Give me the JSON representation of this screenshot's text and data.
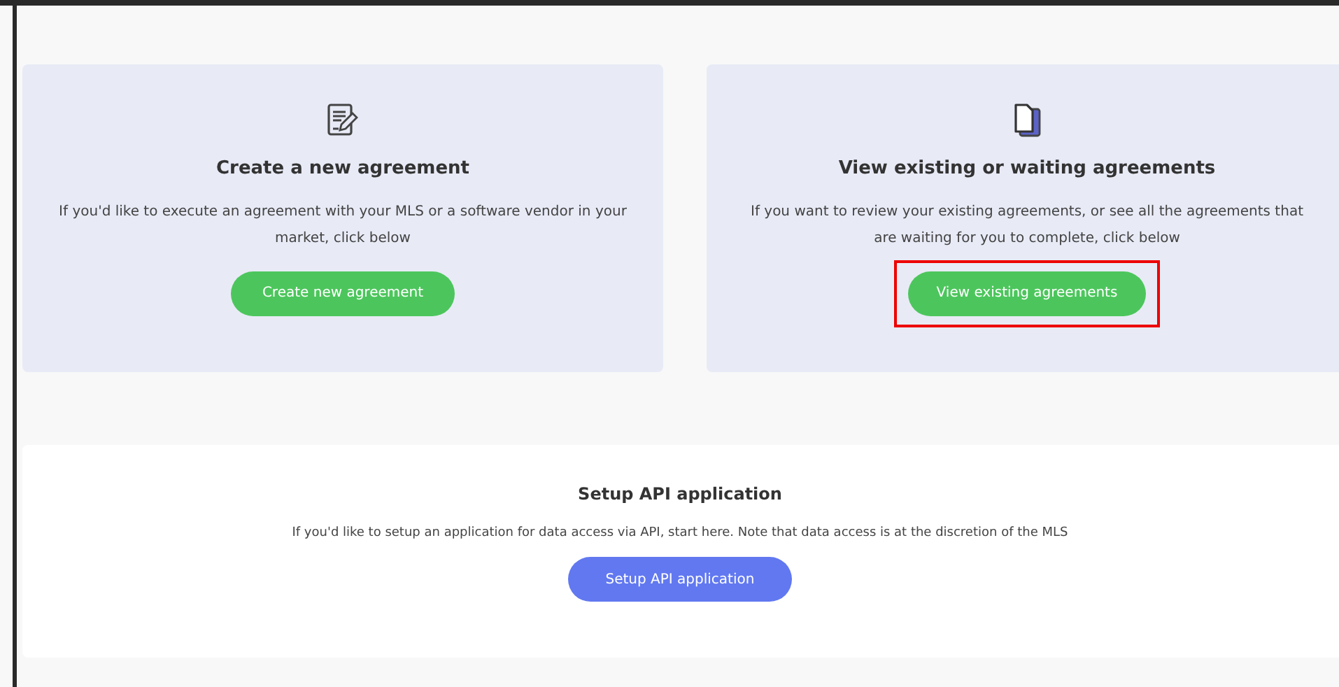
{
  "cards": [
    {
      "title": "Create a new agreement",
      "description": "If you'd like to execute an agreement with your MLS or a software vendor in your market, click below",
      "button": {
        "label": "Create new agreement",
        "highlighted": false
      }
    },
    {
      "title": "View existing or waiting agreements",
      "description": "If you want to review your existing agreements, or see all the agreements that are waiting for you to complete, click below",
      "button": {
        "label": "View existing agreements",
        "highlighted": true
      }
    }
  ],
  "api_section": {
    "title": "Setup API application",
    "description": "If you'd like to setup an application for data access via API, start here. Note that data access is at the discretion of the MLS",
    "button": {
      "label": "Setup API application"
    }
  }
}
